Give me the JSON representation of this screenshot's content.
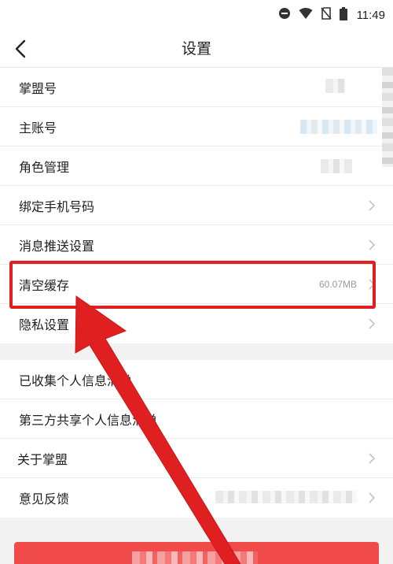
{
  "status_bar": {
    "time": "11:49",
    "icons": [
      "do-not-disturb-icon",
      "wifi-icon",
      "no-sim-icon",
      "battery-icon"
    ]
  },
  "navbar": {
    "back_icon": "chevron-left-icon",
    "title": "设置"
  },
  "settings_group_1": [
    {
      "label": "掌盟号",
      "chevron": false
    },
    {
      "label": "主账号",
      "chevron": false
    },
    {
      "label": "角色管理",
      "chevron": false
    },
    {
      "label": "绑定手机号码",
      "chevron": true
    },
    {
      "label": "消息推送设置",
      "chevron": true
    },
    {
      "label": "清空缓存",
      "value": "60.07MB",
      "chevron": true
    },
    {
      "label": "隐私设置",
      "chevron": true
    }
  ],
  "settings_group_2": [
    {
      "label": "已收集个人信息清单",
      "chevron": false
    },
    {
      "label": "第三方共享个人信息清单",
      "chevron": false
    },
    {
      "label": "关于掌盟",
      "chevron": true
    },
    {
      "label": "意见反馈",
      "chevron": true
    }
  ],
  "annotation": {
    "highlight_color": "#e02020",
    "arrow_color": "#e02020"
  },
  "colors": {
    "background": "#f2f2f2",
    "row_background": "#ffffff",
    "primary_button": "#f04a4a"
  }
}
